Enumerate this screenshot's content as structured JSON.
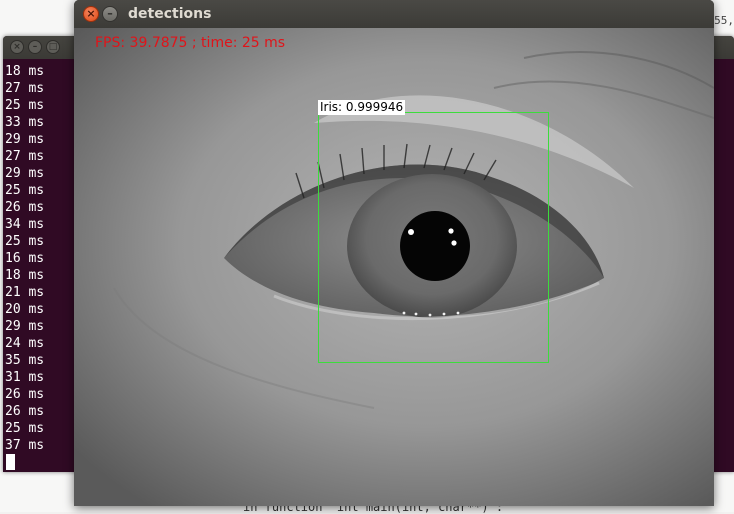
{
  "editor": {
    "corner_text": "55,",
    "code_line": "in function 'int main(int, char**)':"
  },
  "terminal": {
    "lines": [
      "18 ms",
      "27 ms",
      "25 ms",
      "33 ms",
      "29 ms",
      "27 ms",
      "29 ms",
      "25 ms",
      "26 ms",
      "34 ms",
      "25 ms",
      "16 ms",
      "18 ms",
      "21 ms",
      "20 ms",
      "29 ms",
      "24 ms",
      "35 ms",
      "31 ms",
      "26 ms",
      "26 ms",
      "25 ms",
      "37 ms"
    ]
  },
  "window": {
    "title": "detections",
    "close_icon": "close-icon",
    "minimize_icon": "minimize-icon"
  },
  "overlay": {
    "fps_text": "FPS: 39.7875 ; time: 25 ms",
    "detection_label": "Iris: 0.999946"
  },
  "colors": {
    "fps_text": "#e0141a",
    "bbox": "#3cdc3c",
    "terminal_bg": "#300a24",
    "close_button": "#df4a16"
  }
}
